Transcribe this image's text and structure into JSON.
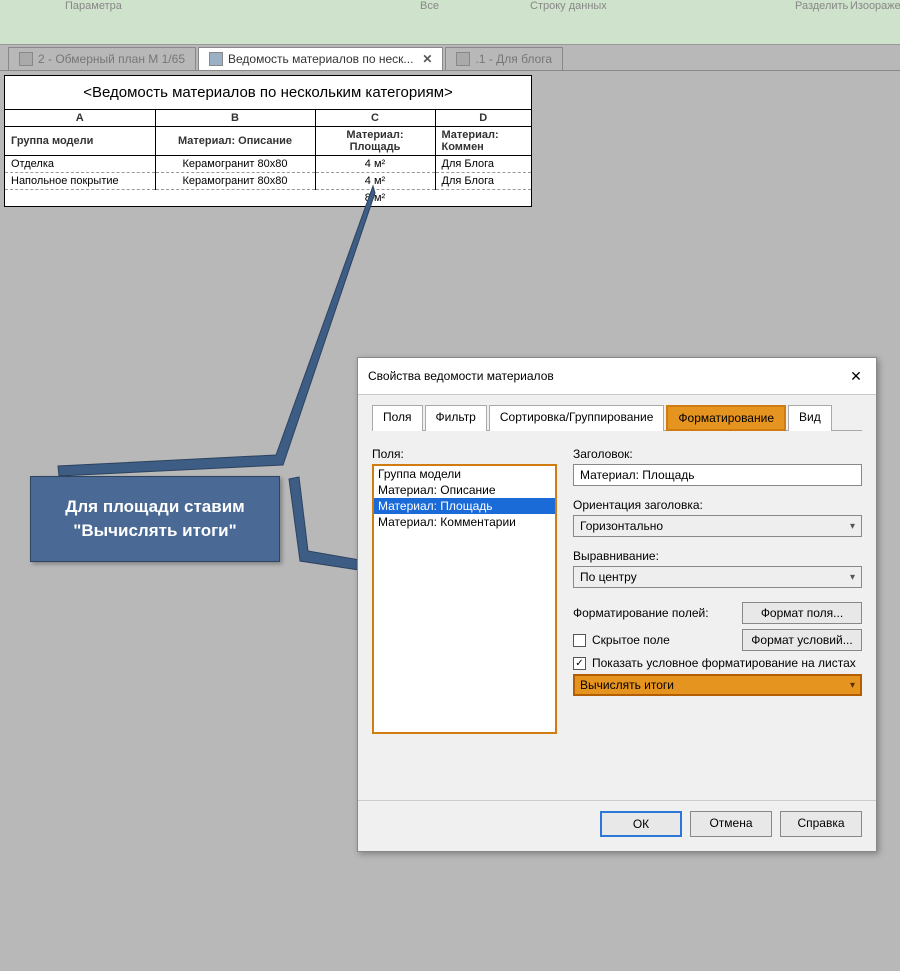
{
  "ribbon_faint_labels": [
    "Параметра",
    "Все",
    "Строку данных",
    "Разделить",
    "Изооражен"
  ],
  "doc_tabs": [
    {
      "label": "2 - Обмерный план М 1/65",
      "active": false,
      "closeable": false
    },
    {
      "label": "Ведомость материалов по неск...",
      "active": true,
      "closeable": true
    },
    {
      "label": ".1 - Для блога",
      "active": false,
      "closeable": false
    }
  ],
  "schedule": {
    "title": "<Ведомость материалов по нескольким категориям>",
    "columns": [
      "A",
      "B",
      "C",
      "D"
    ],
    "headers": [
      "Группа модели",
      "Материал: Описание",
      "Материал: Площадь",
      "Материал: Коммен"
    ],
    "rows": [
      [
        "Отделка",
        "Керамогранит 80x80",
        "4 м²",
        "Для Блога"
      ],
      [
        "Напольное покрытие",
        "Керамогранит 80x80",
        "4 м²",
        "Для Блога"
      ]
    ],
    "total": "8 м²"
  },
  "dialog": {
    "title": "Свойства ведомости материалов",
    "tabs": [
      "Поля",
      "Фильтр",
      "Сортировка/Группирование",
      "Форматирование",
      "Вид"
    ],
    "active_tab": 3,
    "fields_label": "Поля:",
    "fields_list": [
      "Группа модели",
      "Материал: Описание",
      "Материал: Площадь",
      "Материал: Комментарии"
    ],
    "selected_field_index": 2,
    "heading_label": "Заголовок:",
    "heading_value": "Материал: Площадь",
    "orient_label": "Ориентация заголовка:",
    "orient_value": "Горизонтально",
    "align_label": "Выравнивание:",
    "align_value": "По центру",
    "format_fields_label": "Форматирование полей:",
    "format_field_btn": "Формат поля...",
    "hidden_field_label": "Скрытое поле",
    "format_cond_btn": "Формат условий...",
    "show_cond_label": "Показать условное форматирование на листах",
    "calculate_totals_value": "Вычислять итоги",
    "buttons": {
      "ok": "ОК",
      "cancel": "Отмена",
      "help": "Справка"
    }
  },
  "callout": {
    "line1": "Для площади ставим",
    "line2": "\"Вычислять итоги\""
  }
}
